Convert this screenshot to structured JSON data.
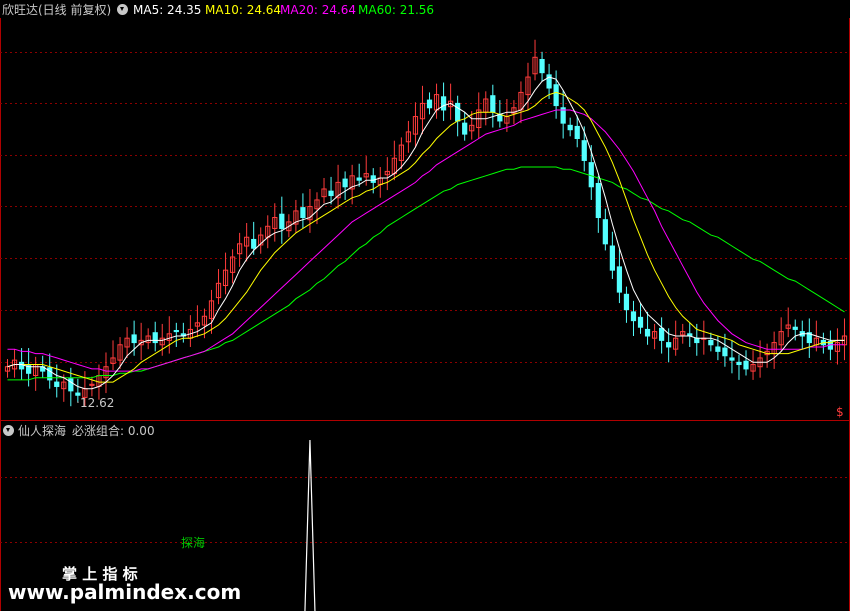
{
  "header": {
    "title": "欣旺达(日线 前复权)",
    "ma_labels": [
      {
        "text": "MA5: 24.35",
        "color": "#ffffff"
      },
      {
        "text": "MA10: 24.64",
        "color": "#ffff00"
      },
      {
        "text": "MA20: 24.64",
        "color": "#ff00ff"
      },
      {
        "text": "MA60: 21.56",
        "color": "#00ff00"
      }
    ]
  },
  "indicator": {
    "title": "仙人探海",
    "value_label": "必涨组合: 0.00",
    "signal_label": "探海"
  },
  "watermark": {
    "line1": "掌 上 指 标",
    "line2": "www.palmindex.com"
  },
  "chart_data": {
    "type": "candlestick",
    "min_label": "12.62",
    "right_marker": "$",
    "price_range": [
      12,
      30
    ],
    "colors": {
      "up": "#ff3c3c",
      "down": "#54ffff",
      "ma5": "#ffffff",
      "ma10": "#ffff00",
      "ma20": "#ff00ff",
      "ma60": "#00ff00",
      "grid": "#8b0000"
    },
    "closes": [
      14.2,
      14.5,
      14.1,
      13.9,
      14.3,
      14.0,
      13.6,
      13.3,
      13.5,
      13.1,
      12.9,
      13.2,
      13.4,
      13.8,
      14.2,
      14.6,
      15.2,
      15.5,
      15.3,
      15.4,
      15.6,
      15.3,
      15.5,
      15.7,
      15.8,
      15.6,
      15.9,
      16.2,
      16.5,
      17.2,
      18.0,
      18.6,
      19.2,
      19.8,
      20.1,
      19.6,
      20.2,
      20.6,
      21.0,
      20.5,
      20.8,
      21.3,
      21.0,
      21.5,
      21.8,
      22.3,
      22.0,
      22.6,
      22.4,
      22.9,
      22.7,
      23.0,
      22.6,
      22.8,
      23.1,
      23.7,
      24.3,
      24.9,
      25.6,
      26.2,
      26.0,
      26.6,
      25.9,
      26.3,
      25.4,
      24.8,
      25.2,
      25.9,
      26.4,
      25.8,
      25.4,
      25.6,
      26.0,
      26.7,
      27.4,
      28.3,
      27.6,
      26.9,
      26.1,
      25.3,
      25.0,
      24.6,
      23.6,
      22.4,
      21.0,
      19.8,
      18.6,
      17.6,
      16.8,
      16.3,
      16.0,
      15.6,
      15.8,
      15.4,
      15.1,
      15.5,
      15.8,
      15.6,
      15.3,
      15.5,
      15.2,
      14.9,
      14.7,
      14.5,
      14.3,
      14.1,
      14.3,
      14.6,
      14.9,
      15.3,
      15.8,
      16.1,
      15.9,
      15.6,
      15.3,
      15.5,
      15.2,
      15.0,
      15.3,
      15.6
    ],
    "ma5": [
      14.2,
      14.3,
      14.3,
      14.2,
      14.2,
      14.2,
      14.0,
      13.8,
      13.7,
      13.5,
      13.3,
      13.2,
      13.2,
      13.3,
      13.5,
      13.8,
      14.2,
      14.7,
      15.0,
      15.3,
      15.4,
      15.4,
      15.4,
      15.5,
      15.6,
      15.6,
      15.7,
      15.8,
      16.0,
      16.2,
      16.8,
      17.3,
      17.9,
      18.6,
      19.1,
      19.5,
      19.8,
      20.1,
      20.3,
      20.4,
      20.6,
      20.8,
      20.9,
      21.0,
      21.3,
      21.6,
      21.7,
      22.0,
      22.2,
      22.4,
      22.5,
      22.7,
      22.7,
      22.8,
      22.8,
      23.0,
      23.3,
      23.7,
      24.2,
      24.9,
      25.4,
      25.9,
      26.1,
      26.2,
      26.0,
      25.8,
      25.5,
      25.5,
      25.5,
      25.6,
      25.7,
      25.8,
      25.8,
      25.9,
      26.3,
      26.8,
      27.2,
      27.4,
      27.3,
      26.8,
      26.2,
      25.6,
      24.9,
      24.0,
      23.0,
      21.9,
      20.7,
      19.6,
      18.6,
      17.7,
      17.1,
      16.6,
      16.3,
      16.0,
      15.7,
      15.6,
      15.6,
      15.6,
      15.5,
      15.5,
      15.5,
      15.4,
      15.2,
      15.0,
      14.8,
      14.6,
      14.4,
      14.4,
      14.4,
      14.6,
      14.9,
      15.3,
      15.6,
      15.7,
      15.7,
      15.6,
      15.5,
      15.4,
      15.4,
      15.4
    ],
    "ma10": [
      14.2,
      14.3,
      14.3,
      14.3,
      14.3,
      14.3,
      14.2,
      14.1,
      14.0,
      13.9,
      13.8,
      13.7,
      13.6,
      13.5,
      13.5,
      13.5,
      13.7,
      13.9,
      14.1,
      14.4,
      14.6,
      14.8,
      15.0,
      15.2,
      15.4,
      15.5,
      15.5,
      15.6,
      15.7,
      15.9,
      16.1,
      16.4,
      16.8,
      17.2,
      17.6,
      18.1,
      18.6,
      19.0,
      19.4,
      19.7,
      20.0,
      20.3,
      20.5,
      20.7,
      20.9,
      21.1,
      21.3,
      21.5,
      21.7,
      21.9,
      22.0,
      22.2,
      22.3,
      22.5,
      22.6,
      22.8,
      23.0,
      23.2,
      23.5,
      23.9,
      24.2,
      24.6,
      24.9,
      25.2,
      25.4,
      25.5,
      25.7,
      25.8,
      25.8,
      25.8,
      25.7,
      25.6,
      25.7,
      25.8,
      25.9,
      26.1,
      26.4,
      26.6,
      26.7,
      26.6,
      26.4,
      26.2,
      25.9,
      25.4,
      24.8,
      24.2,
      23.5,
      22.7,
      21.8,
      20.9,
      20.1,
      19.3,
      18.6,
      18.0,
      17.4,
      16.9,
      16.5,
      16.2,
      15.9,
      15.8,
      15.7,
      15.6,
      15.5,
      15.4,
      15.2,
      15.1,
      15.0,
      14.9,
      14.8,
      14.8,
      14.8,
      14.8,
      14.9,
      15.0,
      15.1,
      15.2,
      15.3,
      15.3,
      15.4,
      15.4
    ],
    "ma20": [
      15.0,
      15.0,
      14.9,
      14.9,
      14.8,
      14.8,
      14.7,
      14.6,
      14.5,
      14.4,
      14.3,
      14.2,
      14.1,
      14.1,
      14.0,
      14.0,
      14.0,
      14.0,
      14.0,
      14.1,
      14.1,
      14.2,
      14.3,
      14.4,
      14.5,
      14.6,
      14.7,
      14.8,
      14.9,
      15.1,
      15.3,
      15.5,
      15.7,
      16.0,
      16.3,
      16.6,
      16.9,
      17.2,
      17.5,
      17.8,
      18.1,
      18.4,
      18.7,
      19.0,
      19.3,
      19.6,
      19.9,
      20.2,
      20.5,
      20.8,
      21.0,
      21.2,
      21.4,
      21.6,
      21.8,
      22.0,
      22.2,
      22.4,
      22.6,
      22.9,
      23.1,
      23.4,
      23.6,
      23.8,
      24.0,
      24.2,
      24.4,
      24.6,
      24.8,
      24.9,
      25.0,
      25.1,
      25.2,
      25.4,
      25.5,
      25.6,
      25.7,
      25.8,
      25.9,
      25.9,
      25.9,
      25.8,
      25.7,
      25.5,
      25.2,
      24.9,
      24.5,
      24.1,
      23.6,
      23.1,
      22.5,
      21.9,
      21.3,
      20.6,
      20.0,
      19.4,
      18.8,
      18.2,
      17.6,
      17.1,
      16.7,
      16.3,
      16.0,
      15.7,
      15.5,
      15.3,
      15.2,
      15.1,
      15.0,
      15.0,
      15.0,
      15.0,
      15.0,
      15.0,
      15.1,
      15.1,
      15.1,
      15.2,
      15.2,
      15.2
    ],
    "ma60": [
      13.6,
      13.6,
      13.6,
      13.6,
      13.7,
      13.7,
      13.7,
      13.7,
      13.7,
      13.7,
      13.7,
      13.7,
      13.7,
      13.8,
      13.8,
      13.8,
      13.9,
      13.9,
      14.0,
      14.0,
      14.1,
      14.2,
      14.3,
      14.4,
      14.5,
      14.6,
      14.7,
      14.8,
      14.9,
      15.0,
      15.1,
      15.3,
      15.4,
      15.6,
      15.8,
      16.0,
      16.2,
      16.4,
      16.6,
      16.8,
      17.0,
      17.3,
      17.5,
      17.7,
      18.0,
      18.2,
      18.5,
      18.8,
      19.0,
      19.3,
      19.6,
      19.8,
      20.1,
      20.3,
      20.6,
      20.8,
      21.0,
      21.2,
      21.4,
      21.6,
      21.8,
      22.0,
      22.2,
      22.3,
      22.5,
      22.6,
      22.7,
      22.8,
      22.9,
      23.0,
      23.1,
      23.2,
      23.2,
      23.3,
      23.3,
      23.3,
      23.3,
      23.3,
      23.3,
      23.2,
      23.2,
      23.1,
      23.0,
      22.9,
      22.8,
      22.7,
      22.6,
      22.4,
      22.3,
      22.1,
      21.9,
      21.8,
      21.6,
      21.4,
      21.3,
      21.1,
      20.9,
      20.8,
      20.6,
      20.4,
      20.2,
      20.1,
      19.9,
      19.7,
      19.5,
      19.3,
      19.1,
      19.0,
      18.8,
      18.6,
      18.4,
      18.2,
      18.1,
      17.9,
      17.7,
      17.5,
      17.3,
      17.1,
      16.9,
      16.7
    ],
    "indicator_spike": {
      "index": 43,
      "value": 1,
      "range": [
        0,
        1
      ]
    }
  }
}
